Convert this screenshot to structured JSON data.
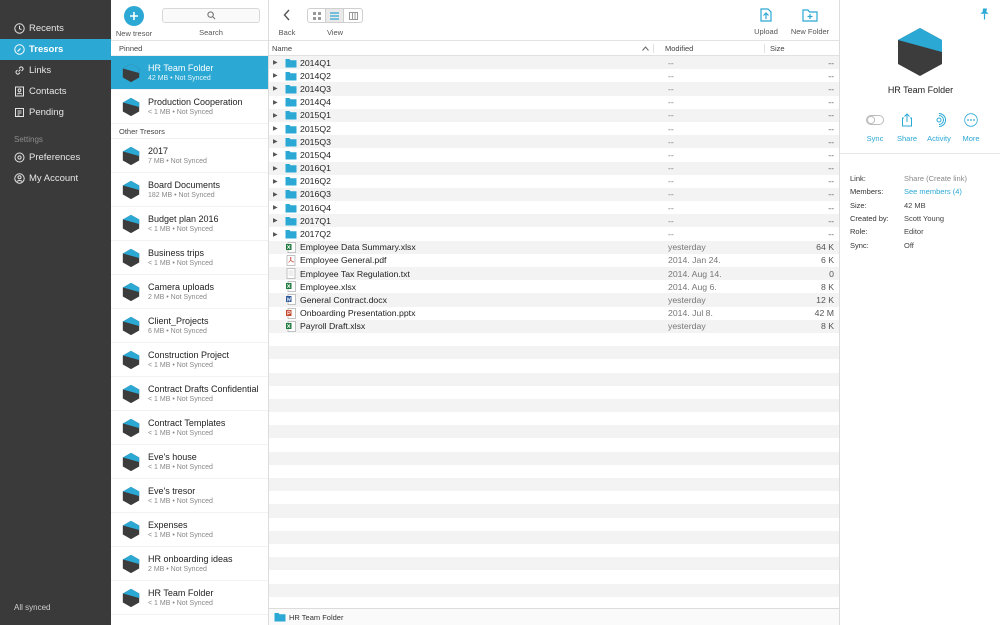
{
  "colors": {
    "accent": "#2ba8d4",
    "nav_bg": "#3a3a3a",
    "hex_dark": "#3c3c3c"
  },
  "nav": {
    "items": [
      {
        "label": "Recents",
        "icon": "clock-icon",
        "active": false
      },
      {
        "label": "Tresors",
        "icon": "compass-icon",
        "active": true
      },
      {
        "label": "Links",
        "icon": "link-icon",
        "active": false
      },
      {
        "label": "Contacts",
        "icon": "contacts-icon",
        "active": false
      },
      {
        "label": "Pending",
        "icon": "pending-icon",
        "active": false
      }
    ],
    "settings_label": "Settings",
    "settings_items": [
      {
        "label": "Preferences",
        "icon": "gear-icon"
      },
      {
        "label": "My Account",
        "icon": "account-icon"
      }
    ],
    "footer": "All synced"
  },
  "tresor_toolbar": {
    "new_label": "New tresor",
    "search_label": "Search"
  },
  "tresors": {
    "pinned_label": "Pinned",
    "pinned": [
      {
        "name": "HR Team Folder",
        "meta": "42 MB • Not Synced",
        "active": true
      },
      {
        "name": "Production Cooperation",
        "meta": "< 1 MB • Not Synced",
        "active": false
      }
    ],
    "other_label": "Other Tresors",
    "other": [
      {
        "name": "2017",
        "meta": "7 MB • Not Synced"
      },
      {
        "name": "Board Documents",
        "meta": "182 MB • Not Synced"
      },
      {
        "name": "Budget plan 2016",
        "meta": "< 1 MB • Not Synced"
      },
      {
        "name": "Business trips",
        "meta": "< 1 MB • Not Synced"
      },
      {
        "name": "Camera uploads",
        "meta": "2 MB • Not Synced"
      },
      {
        "name": "Client_Projects",
        "meta": "6 MB • Not Synced"
      },
      {
        "name": "Construction Project",
        "meta": "< 1 MB • Not Synced"
      },
      {
        "name": "Contract Drafts Confidential",
        "meta": "< 1 MB • Not Synced"
      },
      {
        "name": "Contract Templates",
        "meta": "< 1 MB • Not Synced"
      },
      {
        "name": "Eve's house",
        "meta": "< 1 MB • Not Synced"
      },
      {
        "name": "Eve's tresor",
        "meta": "< 1 MB • Not Synced"
      },
      {
        "name": "Expenses",
        "meta": "< 1 MB • Not Synced"
      },
      {
        "name": "HR onboarding ideas",
        "meta": "2 MB • Not Synced"
      },
      {
        "name": "HR Team Folder",
        "meta": "< 1 MB • Not Synced"
      }
    ]
  },
  "main_toolbar": {
    "back_label": "Back",
    "view_label": "View",
    "upload_label": "Upload",
    "new_folder_label": "New Folder"
  },
  "columns": {
    "name": "Name",
    "modified": "Modified",
    "size": "Size"
  },
  "files": [
    {
      "name": "2014Q1",
      "type": "folder",
      "modified": "--",
      "size": "--"
    },
    {
      "name": "2014Q2",
      "type": "folder",
      "modified": "--",
      "size": "--"
    },
    {
      "name": "2014Q3",
      "type": "folder",
      "modified": "--",
      "size": "--"
    },
    {
      "name": "2014Q4",
      "type": "folder",
      "modified": "--",
      "size": "--"
    },
    {
      "name": "2015Q1",
      "type": "folder",
      "modified": "--",
      "size": "--"
    },
    {
      "name": "2015Q2",
      "type": "folder",
      "modified": "--",
      "size": "--"
    },
    {
      "name": "2015Q3",
      "type": "folder",
      "modified": "--",
      "size": "--"
    },
    {
      "name": "2015Q4",
      "type": "folder",
      "modified": "--",
      "size": "--"
    },
    {
      "name": "2016Q1",
      "type": "folder",
      "modified": "--",
      "size": "--"
    },
    {
      "name": "2016Q2",
      "type": "folder",
      "modified": "--",
      "size": "--"
    },
    {
      "name": "2016Q3",
      "type": "folder",
      "modified": "--",
      "size": "--"
    },
    {
      "name": "2016Q4",
      "type": "folder",
      "modified": "--",
      "size": "--"
    },
    {
      "name": "2017Q1",
      "type": "folder",
      "modified": "--",
      "size": "--"
    },
    {
      "name": "2017Q2",
      "type": "folder",
      "modified": "--",
      "size": "--"
    },
    {
      "name": "Employee Data Summary.xlsx",
      "type": "xlsx",
      "modified": "yesterday",
      "size": "64 K"
    },
    {
      "name": "Employee General.pdf",
      "type": "pdf",
      "modified": "2014. Jan 24.",
      "size": "6 K"
    },
    {
      "name": "Employee Tax Regulation.txt",
      "type": "txt",
      "modified": "2014. Aug 14.",
      "size": "0"
    },
    {
      "name": "Employee.xlsx",
      "type": "xlsx",
      "modified": "2014. Aug 6.",
      "size": "8 K"
    },
    {
      "name": "General Contract.docx",
      "type": "docx",
      "modified": "yesterday",
      "size": "12 K"
    },
    {
      "name": "Onboarding Presentation.pptx",
      "type": "pptx",
      "modified": "2014. Jul 8.",
      "size": "42 M"
    },
    {
      "name": "Payroll Draft.xlsx",
      "type": "xlsx",
      "modified": "yesterday",
      "size": "8 K"
    }
  ],
  "statusbar": {
    "path": "HR Team Folder"
  },
  "detail": {
    "title": "HR Team Folder",
    "actions": [
      {
        "label": "Sync",
        "icon": "sync-toggle-icon"
      },
      {
        "label": "Share",
        "icon": "share-icon"
      },
      {
        "label": "Activity",
        "icon": "activity-icon"
      },
      {
        "label": "More",
        "icon": "more-icon"
      }
    ],
    "props": [
      {
        "key": "Link:",
        "value": "Share (Create link)",
        "style": "muted"
      },
      {
        "key": "Members:",
        "value": "See members (4)",
        "style": "link"
      },
      {
        "key": "Size:",
        "value": "42 MB",
        "style": ""
      },
      {
        "key": "Created by:",
        "value": "Scott Young",
        "style": ""
      },
      {
        "key": "Role:",
        "value": "Editor",
        "style": ""
      },
      {
        "key": "Sync:",
        "value": "Off",
        "style": ""
      }
    ]
  }
}
